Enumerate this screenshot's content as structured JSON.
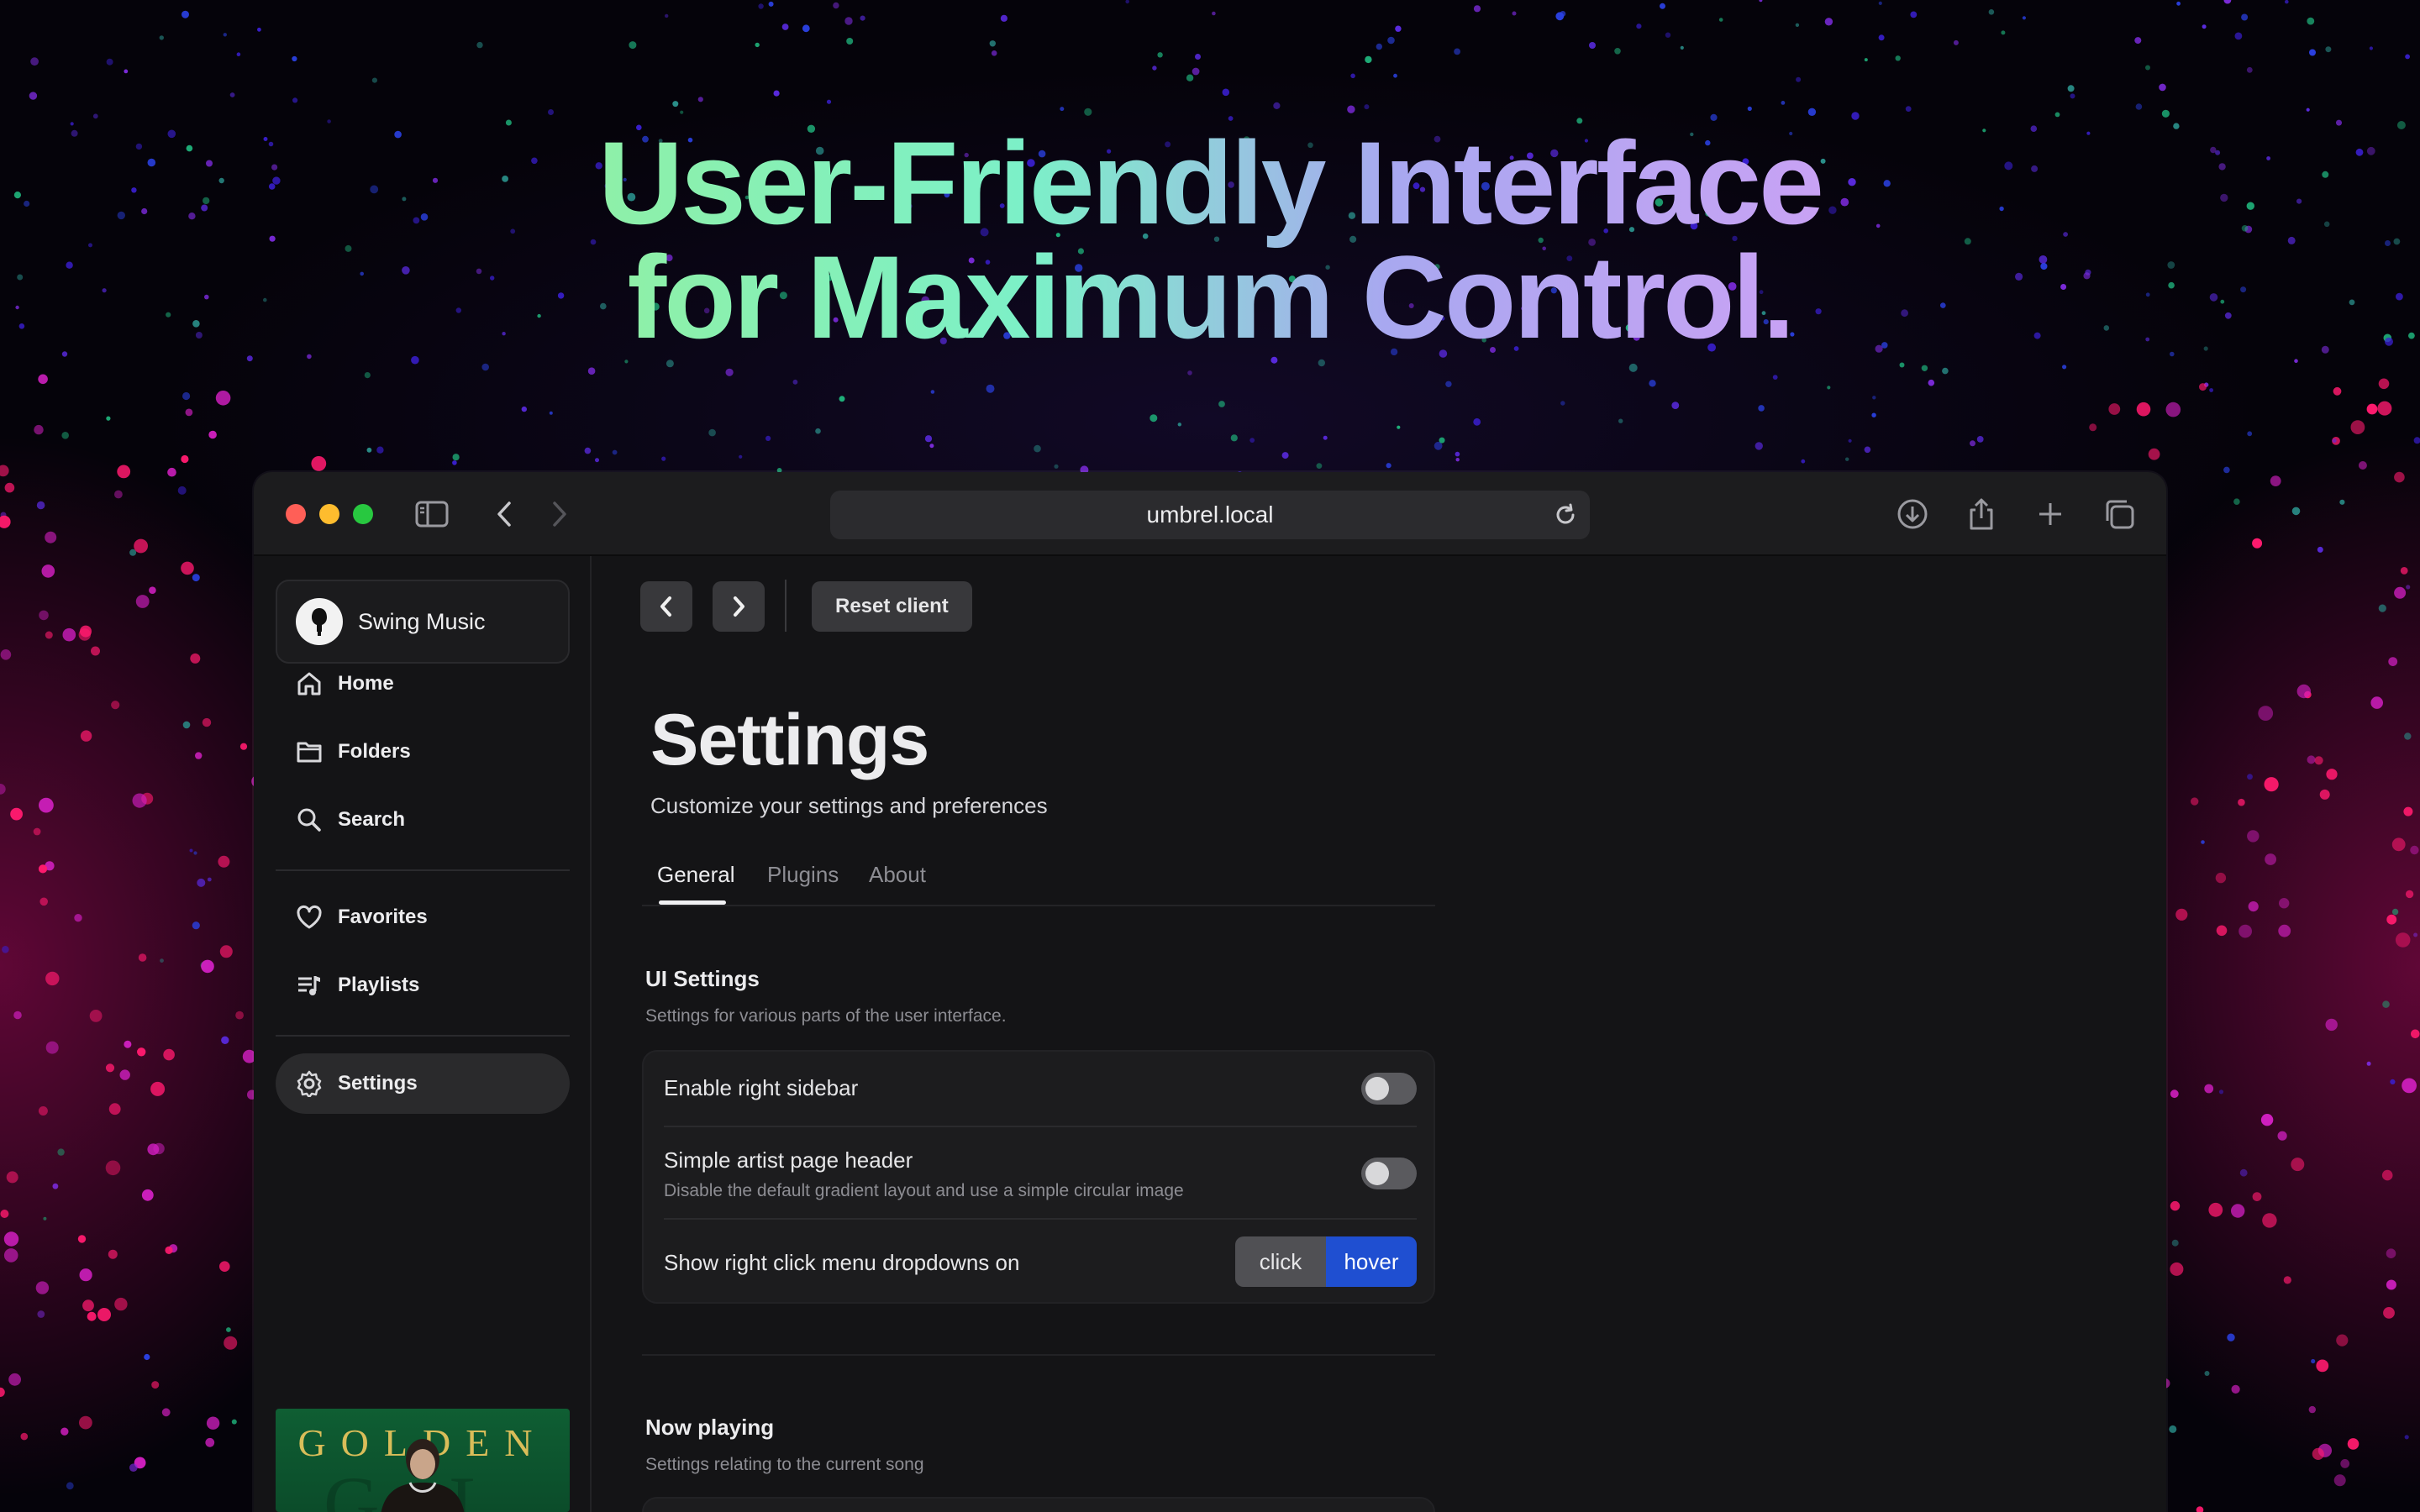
{
  "headline": {
    "line1": "User-Friendly Interface",
    "line2": "for Maximum Control."
  },
  "browser": {
    "url": "umbrel.local",
    "icons": [
      "sidebar-toggle-icon",
      "back-arrow-icon",
      "forward-arrow-icon",
      "reload-icon",
      "download-icon",
      "share-icon",
      "plus-icon",
      "tabs-icon"
    ]
  },
  "sidebar": {
    "brand": "Swing Music",
    "items": [
      {
        "label": "Home",
        "icon": "home-icon"
      },
      {
        "label": "Folders",
        "icon": "folder-icon"
      },
      {
        "label": "Search",
        "icon": "search-icon"
      },
      {
        "label": "Favorites",
        "icon": "heart-icon"
      },
      {
        "label": "Playlists",
        "icon": "playlist-icon"
      },
      {
        "label": "Settings",
        "icon": "gear-icon",
        "active": true
      }
    ],
    "album_art_text": "GOLDEN"
  },
  "toolbar": {
    "reset_label": "Reset client"
  },
  "settings": {
    "title": "Settings",
    "subtitle": "Customize your settings and preferences",
    "tabs": [
      "General",
      "Plugins",
      "About"
    ],
    "active_tab": "General",
    "sections": [
      {
        "title": "UI Settings",
        "description": "Settings for various parts of the user interface.",
        "rows": [
          {
            "label": "Enable right sidebar",
            "type": "toggle",
            "value": false
          },
          {
            "label": "Simple artist page header",
            "description": "Disable the default gradient layout and use a simple circular image",
            "type": "toggle",
            "value": false
          },
          {
            "label": "Show right click menu dropdowns on",
            "type": "segmented",
            "options": [
              "click",
              "hover"
            ],
            "selected": "hover"
          }
        ]
      },
      {
        "title": "Now playing",
        "description": "Settings relating to the current song"
      }
    ]
  },
  "colors": {
    "accent": "#1f4fd1",
    "window_bg": "#141416",
    "titlebar_bg": "#1c1c1e",
    "close": "#ff5f57",
    "minimize": "#febc2e",
    "zoom": "#28c840"
  }
}
